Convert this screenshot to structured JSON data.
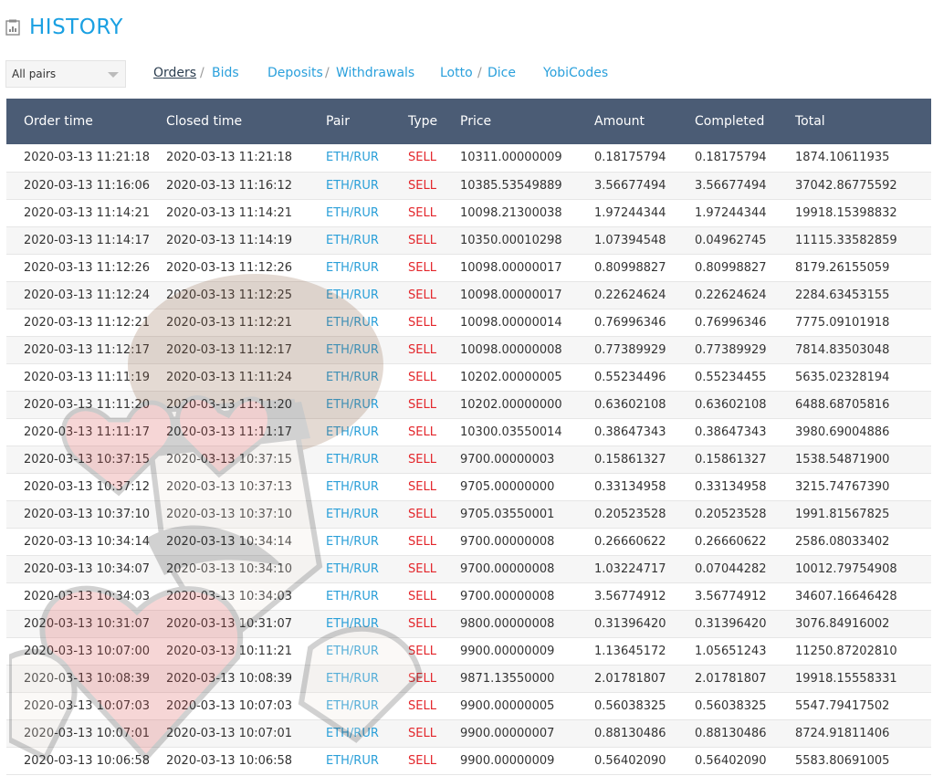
{
  "header": {
    "title": "HISTORY",
    "icon": "history-icon"
  },
  "filter": {
    "selected": "All pairs"
  },
  "nav": {
    "orders": "Orders",
    "bids": "Bids",
    "deposits": "Deposits",
    "withdrawals": "Withdrawals",
    "lotto": "Lotto",
    "dice": "Dice",
    "yobicodes": "YobiCodes",
    "separator": "/"
  },
  "colors": {
    "accent": "#1aa0e2",
    "header_bg": "#4b5c75",
    "sell": "#e3262b",
    "link": "#2a9fd8"
  },
  "table": {
    "columns": [
      "Order time",
      "Closed time",
      "Pair",
      "Type",
      "Price",
      "Amount",
      "Completed",
      "Total"
    ],
    "rows": [
      [
        "2020-03-13 11:21:18",
        "2020-03-13 11:21:18",
        "ETH/RUR",
        "SELL",
        "10311.00000009",
        "0.18175794",
        "0.18175794",
        "1874.10611935"
      ],
      [
        "2020-03-13 11:16:06",
        "2020-03-13 11:16:12",
        "ETH/RUR",
        "SELL",
        "10385.53549889",
        "3.56677494",
        "3.56677494",
        "37042.86775592"
      ],
      [
        "2020-03-13 11:14:21",
        "2020-03-13 11:14:21",
        "ETH/RUR",
        "SELL",
        "10098.21300038",
        "1.97244344",
        "1.97244344",
        "19918.15398832"
      ],
      [
        "2020-03-13 11:14:17",
        "2020-03-13 11:14:19",
        "ETH/RUR",
        "SELL",
        "10350.00010298",
        "1.07394548",
        "0.04962745",
        "11115.33582859"
      ],
      [
        "2020-03-13 11:12:26",
        "2020-03-13 11:12:26",
        "ETH/RUR",
        "SELL",
        "10098.00000017",
        "0.80998827",
        "0.80998827",
        "8179.26155059"
      ],
      [
        "2020-03-13 11:12:24",
        "2020-03-13 11:12:25",
        "ETH/RUR",
        "SELL",
        "10098.00000017",
        "0.22624624",
        "0.22624624",
        "2284.63453155"
      ],
      [
        "2020-03-13 11:12:21",
        "2020-03-13 11:12:21",
        "ETH/RUR",
        "SELL",
        "10098.00000014",
        "0.76996346",
        "0.76996346",
        "7775.09101918"
      ],
      [
        "2020-03-13 11:12:17",
        "2020-03-13 11:12:17",
        "ETH/RUR",
        "SELL",
        "10098.00000008",
        "0.77389929",
        "0.77389929",
        "7814.83503048"
      ],
      [
        "2020-03-13 11:11:19",
        "2020-03-13 11:11:24",
        "ETH/RUR",
        "SELL",
        "10202.00000005",
        "0.55234496",
        "0.55234455",
        "5635.02328194"
      ],
      [
        "2020-03-13 11:11:20",
        "2020-03-13 11:11:20",
        "ETH/RUR",
        "SELL",
        "10202.00000000",
        "0.63602108",
        "0.63602108",
        "6488.68705816"
      ],
      [
        "2020-03-13 11:11:17",
        "2020-03-13 11:11:17",
        "ETH/RUR",
        "SELL",
        "10300.03550014",
        "0.38647343",
        "0.38647343",
        "3980.69004886"
      ],
      [
        "2020-03-13 10:37:15",
        "2020-03-13 10:37:15",
        "ETH/RUR",
        "SELL",
        "9700.00000003",
        "0.15861327",
        "0.15861327",
        "1538.54871900"
      ],
      [
        "2020-03-13 10:37:12",
        "2020-03-13 10:37:13",
        "ETH/RUR",
        "SELL",
        "9705.00000000",
        "0.33134958",
        "0.33134958",
        "3215.74767390"
      ],
      [
        "2020-03-13 10:37:10",
        "2020-03-13 10:37:10",
        "ETH/RUR",
        "SELL",
        "9705.03550001",
        "0.20523528",
        "0.20523528",
        "1991.81567825"
      ],
      [
        "2020-03-13 10:34:14",
        "2020-03-13 10:34:14",
        "ETH/RUR",
        "SELL",
        "9700.00000008",
        "0.26660622",
        "0.26660622",
        "2586.08033402"
      ],
      [
        "2020-03-13 10:34:07",
        "2020-03-13 10:34:10",
        "ETH/RUR",
        "SELL",
        "9700.00000008",
        "1.03224717",
        "0.07044282",
        "10012.79754908"
      ],
      [
        "2020-03-13 10:34:03",
        "2020-03-13 10:34:03",
        "ETH/RUR",
        "SELL",
        "9700.00000008",
        "3.56774912",
        "3.56774912",
        "34607.16646428"
      ],
      [
        "2020-03-13 10:31:07",
        "2020-03-13 10:31:07",
        "ETH/RUR",
        "SELL",
        "9800.00000008",
        "0.31396420",
        "0.31396420",
        "3076.84916002"
      ],
      [
        "2020-03-13 10:07:00",
        "2020-03-13 10:11:21",
        "ETH/RUR",
        "SELL",
        "9900.00000009",
        "1.13645172",
        "1.05651243",
        "11250.87202810"
      ],
      [
        "2020-03-13 10:08:39",
        "2020-03-13 10:08:39",
        "ETH/RUR",
        "SELL",
        "9871.13550000",
        "2.01781807",
        "2.01781807",
        "19918.15558331"
      ],
      [
        "2020-03-13 10:07:03",
        "2020-03-13 10:07:03",
        "ETH/RUR",
        "SELL",
        "9900.00000005",
        "0.56038325",
        "0.56038325",
        "5547.79417502"
      ],
      [
        "2020-03-13 10:07:01",
        "2020-03-13 10:07:01",
        "ETH/RUR",
        "SELL",
        "9900.00000007",
        "0.88130486",
        "0.88130486",
        "8724.91811406"
      ],
      [
        "2020-03-13 10:06:58",
        "2020-03-13 10:06:58",
        "ETH/RUR",
        "SELL",
        "9900.00000009",
        "0.56402090",
        "0.56402090",
        "5583.80691005"
      ]
    ]
  }
}
